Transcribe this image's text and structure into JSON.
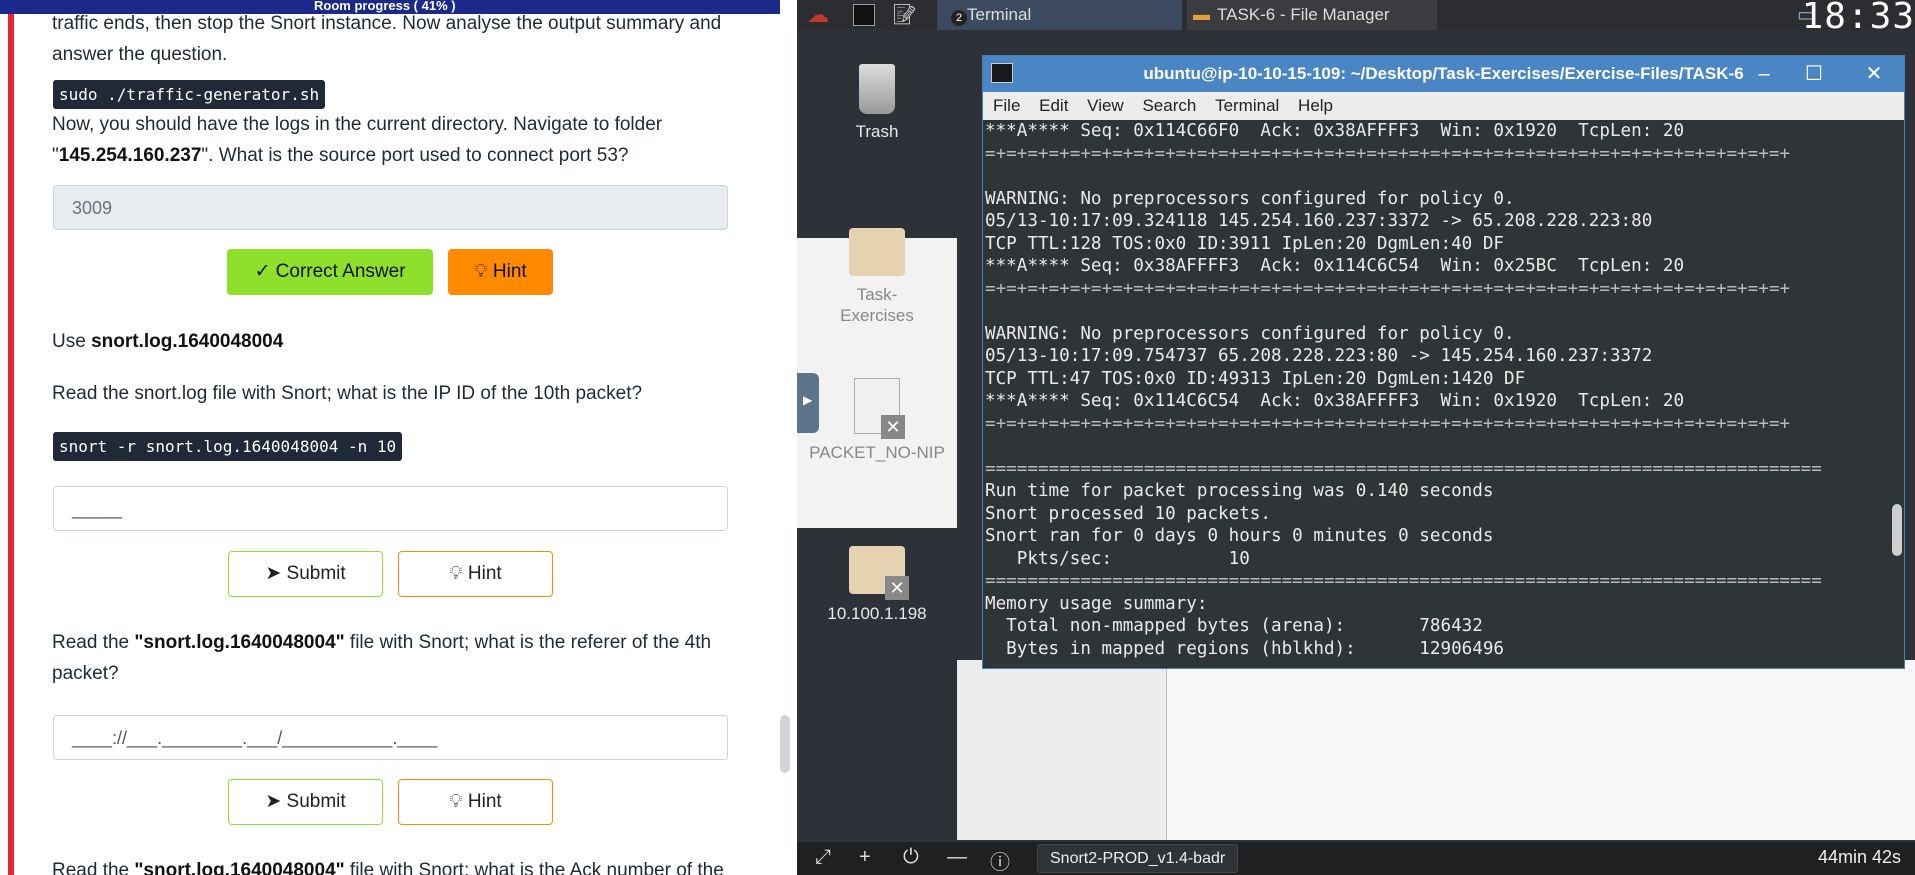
{
  "room": {
    "progress_label": "Room progress ( 41% )"
  },
  "questions": {
    "q_traffic": {
      "text_top": "traffic ends, then stop the Snort instance. Now analyse the output summary and",
      "text_bottom": "answer the question.",
      "command": "sudo ./traffic-generator.sh",
      "text2_line1": "Now, you should have the logs in the current directory. Navigate to folder",
      "text2_q": "\"",
      "text2_bold": "145.254.160.237",
      "text2_rest": "\". What is the source port used to connect port 53?",
      "answer": "3009",
      "correct_label": "Correct Answer",
      "hint_label": "Hint"
    },
    "q_ipid": {
      "use_prefix": "Use ",
      "use_file": "snort.log.1640048004",
      "text": "Read the snort.log file with Snort; what is the IP ID of the 10th packet?",
      "command": "snort -r snort.log.1640048004 -n 10",
      "placeholder": "_____",
      "submit_label": "Submit",
      "hint_label": "Hint"
    },
    "q_referer": {
      "prefix": "Read the ",
      "bold": "\"snort.log.1640048004\"",
      "suffix": " file with Snort; what is the referer of the 4th",
      "line2": "packet?",
      "placeholder": "____://___.________.___/___________.____",
      "submit_label": "Submit",
      "hint_label": "Hint"
    },
    "q_ack": {
      "prefix": "Read the ",
      "bold": "\"snort.log.1640048004\"",
      "suffix": " file with Snort; what is the Ack number of the"
    }
  },
  "desktop": {
    "taskbar": {
      "terminal_label": "Terminal",
      "terminal_count": "2",
      "file_manager_label": "TASK-6 - File Manager",
      "clock": "18:33"
    },
    "icons": [
      {
        "label": "Trash"
      },
      {
        "label": "Task-Exercises"
      },
      {
        "label": "PACKET_NO-NIP"
      },
      {
        "label": "10.100.1.198"
      }
    ],
    "bottom": {
      "machine": "Snort2-PROD_v1.4-badr",
      "timer": "44min 42s"
    }
  },
  "terminal": {
    "title": "ubuntu@ip-10-10-15-109: ~/Desktop/Task-Exercises/Exercise-Files/TASK-6",
    "menu": [
      "File",
      "Edit",
      "View",
      "Search",
      "Terminal",
      "Help"
    ],
    "lines": [
      "***A**** Seq: 0x114C66F0  Ack: 0x38AFFFF3  Win: 0x1920  TcpLen: 20",
      "=+=+=+=+=+=+=+=+=+=+=+=+=+=+=+=+=+=+=+=+=+=+=+=+=+=+=+=+=+=+=+=+=+=+=+=+=+=+",
      "",
      "WARNING: No preprocessors configured for policy 0.",
      "05/13-10:17:09.324118 145.254.160.237:3372 -> 65.208.228.223:80",
      "TCP TTL:128 TOS:0x0 ID:3911 IpLen:20 DgmLen:40 DF",
      "***A**** Seq: 0x38AFFFF3  Ack: 0x114C6C54  Win: 0x25BC  TcpLen: 20",
      "=+=+=+=+=+=+=+=+=+=+=+=+=+=+=+=+=+=+=+=+=+=+=+=+=+=+=+=+=+=+=+=+=+=+=+=+=+=+",
      "",
      "WARNING: No preprocessors configured for policy 0.",
      "05/13-10:17:09.754737 65.208.228.223:80 -> 145.254.160.237:3372",
      "TCP TTL:47 TOS:0x0 ID:49313 IpLen:20 DgmLen:1420 DF",
      "***A**** Seq: 0x114C6C54  Ack: 0x38AFFFF3  Win: 0x1920  TcpLen: 20",
      "=+=+=+=+=+=+=+=+=+=+=+=+=+=+=+=+=+=+=+=+=+=+=+=+=+=+=+=+=+=+=+=+=+=+=+=+=+=+",
      "",
      "===============================================================================",
      "Run time for packet processing was 0.140 seconds",
      "Snort processed 10 packets.",
      "Snort ran for 0 days 0 hours 0 minutes 0 seconds",
      "   Pkts/sec:           10",
      "===============================================================================",
      "Memory usage summary:",
      "  Total non-mmapped bytes (arena):       786432",
      "  Bytes in mapped regions (hblkhd):      12906496"
    ]
  }
}
